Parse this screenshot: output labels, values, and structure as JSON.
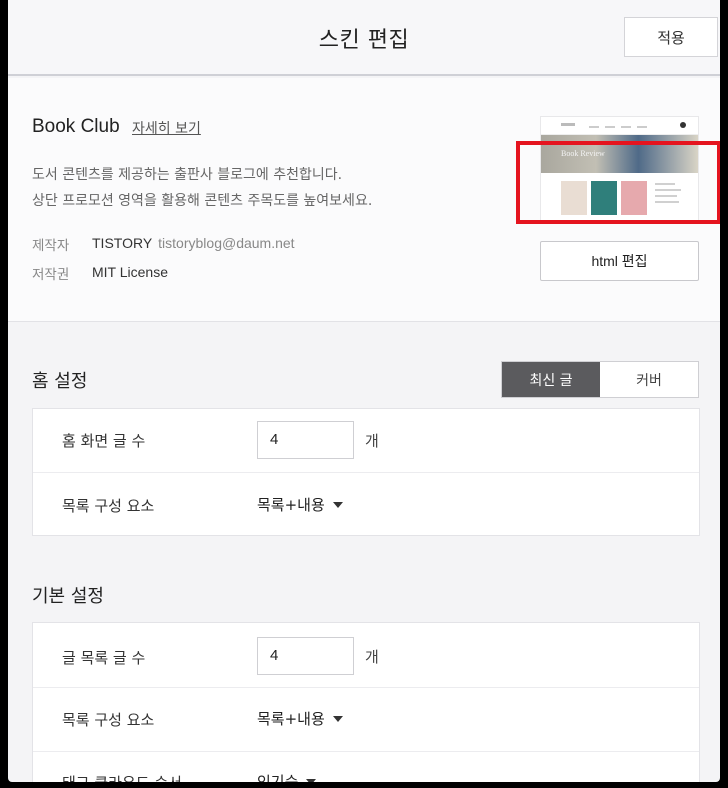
{
  "header": {
    "title": "스킨 편집",
    "apply_label": "적용"
  },
  "skin": {
    "name": "Book Club",
    "detail_link": "자세히 보기",
    "description_line1": "도서 콘텐츠를 제공하는 출판사 블로그에 추천합니다.",
    "description_line2": "상단 프로모션 영역을 활용해 콘텐츠 주목도를 높여보세요.",
    "author_label": "제작자",
    "author_value": "TISTORY",
    "author_email": "tistoryblog@daum.net",
    "license_label": "저작권",
    "license_value": "MIT License",
    "html_edit_label": "html 편집",
    "thumbnail_caption": "Book Review"
  },
  "home_settings": {
    "title": "홈 설정",
    "toggle": {
      "options": [
        "최신 글",
        "커버"
      ],
      "selected": "최신 글"
    },
    "post_count_label": "홈 화면 글 수",
    "post_count_value": "4",
    "post_count_unit": "개",
    "list_element_label": "목록 구성 요소",
    "list_element_value": "목록+내용"
  },
  "basic_settings": {
    "title": "기본 설정",
    "post_count_label": "글 목록 글 수",
    "post_count_value": "4",
    "post_count_unit": "개",
    "list_element_label": "목록 구성 요소",
    "list_element_value": "목록+내용",
    "tag_cloud_label": "태그 클라우드 순서",
    "tag_cloud_value": "인기순"
  },
  "colors": {
    "highlight": "#e5141f",
    "toggle_active": "#5b5b5e"
  }
}
